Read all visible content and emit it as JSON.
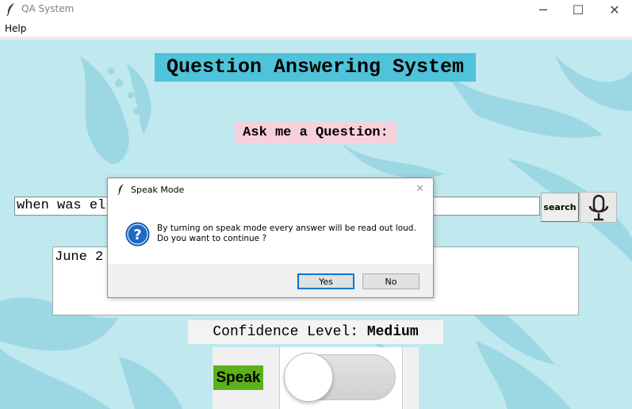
{
  "window": {
    "title": "QA System",
    "minimize_glyph": "─",
    "maximize_glyph": "☐",
    "close_glyph": "✕"
  },
  "menu": {
    "help": "Help"
  },
  "main": {
    "title": "Question Answering System",
    "ask_label": "Ask me a Question:",
    "question_value": "when was el",
    "search_label": "search",
    "answer_text": "June 2",
    "confidence_label": "Confidence Level:",
    "confidence_value": "Medium",
    "speak_label": "Speak",
    "speak_toggle_on": false
  },
  "dialog": {
    "title": "Speak Mode",
    "close_glyph": "✕",
    "message_line1": "By turning on speak mode every answer will be read out loud.",
    "message_line2": "Do you want to continue ?",
    "yes_label": "Yes",
    "no_label": "No"
  },
  "colors": {
    "background": "#bfe8ef",
    "title_bg": "#4fc3d9",
    "ask_bg": "#f6d1dc",
    "speak_bg": "#5ab119",
    "dialog_accent": "#0078d7"
  }
}
